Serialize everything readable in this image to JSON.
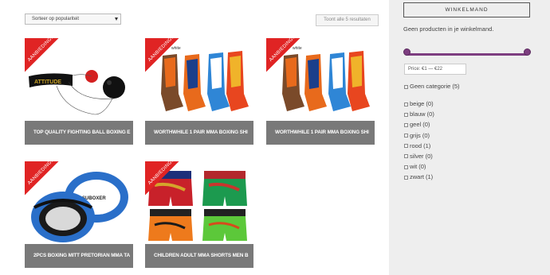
{
  "toolbar": {
    "sort_value": "Sorteer op populariteit",
    "result_count": "Toont alle 5 resultaten"
  },
  "products": [
    {
      "title": "TOP QUALITY FIGHTING BALL BOXING E",
      "badge": "AANBIEDING!",
      "image": "fight-ball-headband-image"
    },
    {
      "title": "WORTHWHILE 1 PAIR MMA BOXING SHI",
      "badge": "AANBIEDING!",
      "image": "shin-guards-image"
    },
    {
      "title": "WORTHWHILE 1 PAIR MMA BOXING SHI",
      "badge": "AANBIEDING!",
      "image": "shin-guards-image"
    },
    {
      "title": "2PCS BOXING MITT PRETORIAN MMA TA",
      "badge": "AANBIEDING!",
      "image": "focus-mitts-image"
    },
    {
      "title": "CHILDREN ADULT MMA SHORTS MEN B",
      "badge": "AANBIEDING!",
      "image": "mma-shorts-image"
    }
  ],
  "sidebar": {
    "cart_button": "WINKELMAND",
    "cart_empty": "Geen producten in je winkelmand.",
    "price_label": "Price: €1 — €22",
    "price_min": 1,
    "price_max": 22,
    "category_label": "Geen categorie (5)",
    "colors": [
      {
        "label": "beige (0)"
      },
      {
        "label": "blauw (0)"
      },
      {
        "label": "geel (0)"
      },
      {
        "label": "grijs (0)"
      },
      {
        "label": "rood (1)"
      },
      {
        "label": "silver (0)"
      },
      {
        "label": "wit (0)"
      },
      {
        "label": "zwart (1)"
      }
    ]
  },
  "colors": {
    "badge_red": "#e02424",
    "caption_grey": "#6e6e6e",
    "slider_purple": "#7d3e80",
    "sidebar_bg": "#eeeeee"
  }
}
